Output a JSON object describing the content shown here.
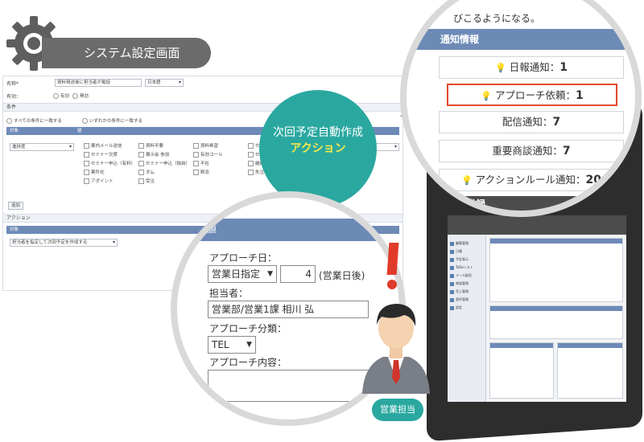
{
  "title": {
    "label": "システム設定画面"
  },
  "form": {
    "name_label": "名称*",
    "name_value": "資料発送後に担当者が電話",
    "language": "日本語",
    "valid_label": "有効：",
    "valid_on": "有効",
    "valid_off": "無効",
    "conditions_label": "条件",
    "match_all": "すべての条件に一致する",
    "match_any": "いずれかの条件に一致する",
    "col_target": "対象",
    "col_value": "値",
    "target_select": "進捗度",
    "checkboxes": [
      "案内メール送信",
      "資料不要",
      "資料希望",
      "セミナー参加",
      "セミナー欠席",
      "展示会 参加",
      "有効コール",
      "セミナー申込（無料）",
      "セミナー申込（有料）",
      "セミナー申込（独自）",
      "不在",
      "継続フォロー",
      "案件化",
      "ダム",
      "断念",
      "失注",
      "アポイント",
      "受注"
    ],
    "add_button": "追加",
    "action_label": "アクション",
    "action_select": "担当者を指定して次回予定を作成する"
  },
  "bubble": {
    "line1": "次回予定自動作成",
    "line2": "アクション"
  },
  "value_panel": {
    "header": "値",
    "approach_date_label": "アプローチ日：",
    "approach_date_select": "営業日指定",
    "approach_days": "4",
    "approach_days_unit": "(営業日後)",
    "owner_label": "担当者：",
    "owner_value": "営業部/営業1課 相川 弘",
    "type_label": "アプローチ分類：",
    "type_value": "TEL",
    "content_label": "アプローチ内容："
  },
  "notifications": {
    "top_text": "びこるようになる。",
    "header": "通知情報",
    "items": [
      {
        "label": "日報通知：",
        "count": "1",
        "bulb": true,
        "highlight": false
      },
      {
        "label": "アプローチ依頼：",
        "count": "1",
        "bulb": true,
        "highlight": true
      },
      {
        "label": "配信通知：",
        "count": "7",
        "bulb": false,
        "highlight": false
      },
      {
        "label": "重要商談通知：",
        "count": "7",
        "bulb": false,
        "highlight": false
      },
      {
        "label": "アクションルール通知：",
        "count": "20",
        "bulb": true,
        "highlight": false
      }
    ],
    "register_header": "情報登録"
  },
  "tablet": {
    "side_items": [
      "顧客管理",
      "日報",
      "予定表示",
      "ToDoリスト",
      "メール配信",
      "商談管理",
      "売上管理",
      "案件管理",
      "設定"
    ]
  },
  "person": {
    "role": "営業担当"
  },
  "colors": {
    "accent": "#2aa8a0",
    "header_blue": "#6d8ab7",
    "highlight": "#e04a2a",
    "yellow": "#f7e84a"
  }
}
